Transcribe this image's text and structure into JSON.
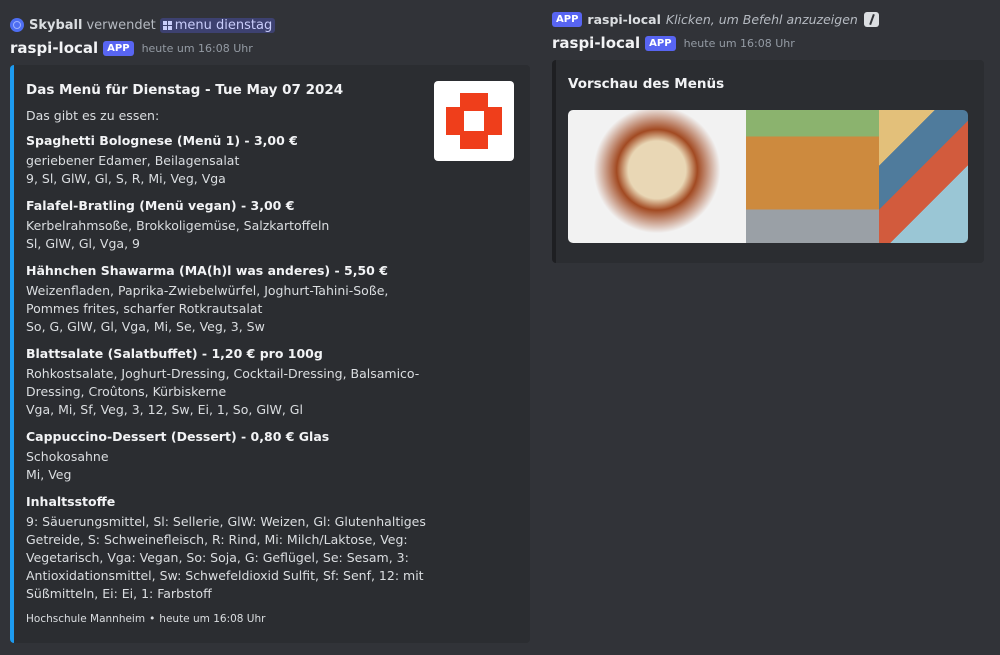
{
  "left": {
    "reply": {
      "user": "Skyball",
      "verb": "verwendet",
      "command": "menu dienstag"
    },
    "author": "raspi-local",
    "badge": "APP",
    "time": "heute um 16:08 Uhr",
    "embed": {
      "title": "Das Menü für Dienstag - Tue May 07 2024",
      "intro": "Das gibt es zu essen:",
      "fields": [
        {
          "name": "Spaghetti Bolognese (Menü 1) - 3,00 €",
          "value": "geriebener Edamer, Beilagensalat\n9, Sl, GlW, Gl, S, R, Mi, Veg, Vga"
        },
        {
          "name": "Falafel-Bratling (Menü vegan) - 3,00 €",
          "value": "Kerbelrahmsoße, Brokkoligemüse, Salzkartoffeln\nSl, GlW, Gl, Vga, 9"
        },
        {
          "name": "Hähnchen Shawarma (MA(h)l was anderes) - 5,50 €",
          "value": "Weizenfladen, Paprika-Zwiebelwürfel, Joghurt-Tahini-Soße,\nPommes frites, scharfer Rotkrautsalat\nSo, G, GlW, Gl, Vga, Mi, Se, Veg, 3, Sw"
        },
        {
          "name": "Blattsalate (Salatbuffet) - 1,20 € pro 100g",
          "value": "Rohkostsalate, Joghurt-Dressing, Cocktail-Dressing, Balsamico-\nDressing, Croûtons, Kürbiskerne\nVga, Mi, Sf, Veg, 3, 12, Sw, Ei, 1, So, GlW, Gl"
        },
        {
          "name": "Cappuccino-Dessert (Dessert) - 0,80 € Glas",
          "value": "Schokosahne\nMi, Veg"
        },
        {
          "name": "Inhaltsstoffe",
          "value": "9: Säuerungsmittel, Sl: Sellerie, GlW: Weizen, Gl: Glutenhaltiges\nGetreide, S: Schweinefleisch, R: Rind, Mi: Milch/Laktose, Veg:\nVegetarisch, Vga: Vegan, So: Soja, G: Geflügel, Se: Sesam, 3:\nAntioxidationsmittel, Sw: Schwefeldioxid Sulfit, Sf: Senf, 12: mit\nSüßmitteln, Ei: Ei, 1: Farbstoff"
        }
      ],
      "footer_source": "Hochschule Mannheim",
      "footer_sep": "•",
      "footer_time": "heute um 16:08 Uhr"
    }
  },
  "right": {
    "reply": {
      "badge": "APP",
      "author": "raspi-local",
      "hint": "Klicken, um Befehl anzuzeigen"
    },
    "author": "raspi-local",
    "badge": "APP",
    "time": "heute um 16:08 Uhr",
    "embed_title": "Vorschau des Menüs"
  },
  "colors": {
    "background": "#313338",
    "embed_bg": "#2b2d31",
    "accent_bar": "#1d9bf0",
    "app_badge": "#5865f2",
    "logo": "#ef3e1b"
  }
}
